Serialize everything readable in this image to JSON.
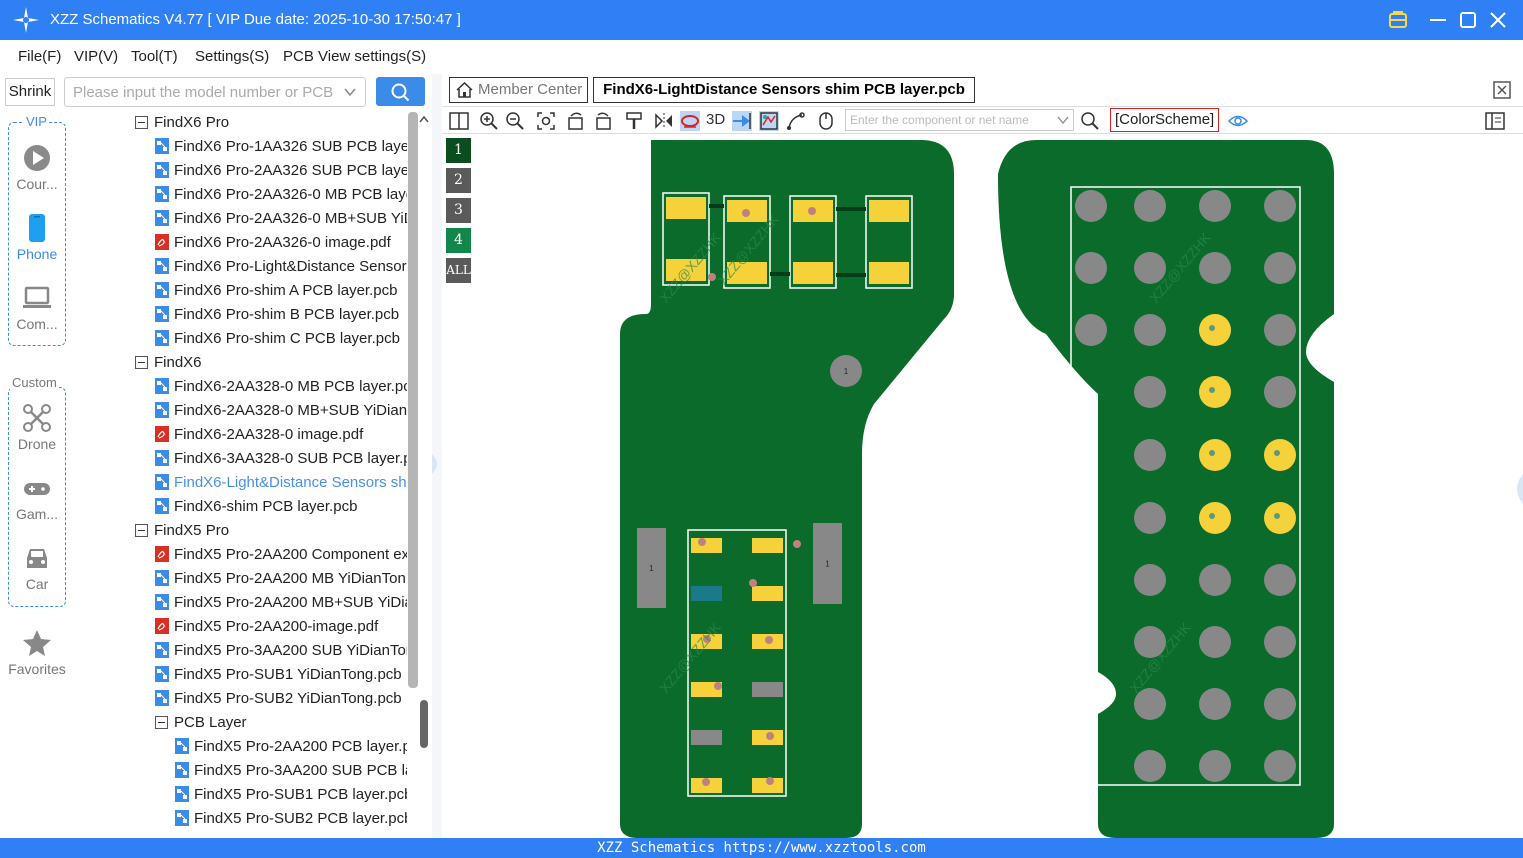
{
  "window": {
    "title": "XZZ Schematics V4.77 [ VIP Due date: 2025-10-30 17:50:47 ]"
  },
  "menu": [
    "File(F)",
    "VIP(V)",
    "Tool(T)",
    "Settings(S)",
    "PCB View settings(S)"
  ],
  "search": {
    "shrink_label": "Shrink",
    "placeholder": "Please input the model number or PCB"
  },
  "nav": {
    "vip_title": "VIP",
    "custom_title": "Custom",
    "items": [
      {
        "label": "Cour...",
        "icon": "play-icon"
      },
      {
        "label": "Phone",
        "icon": "phone-icon",
        "active": true
      },
      {
        "label": "Com...",
        "icon": "laptop-icon"
      },
      {
        "label": "Drone",
        "icon": "drone-icon"
      },
      {
        "label": "Gam...",
        "icon": "gamepad-icon"
      },
      {
        "label": "Car",
        "icon": "car-icon"
      },
      {
        "label": "Favorites",
        "icon": "star-icon"
      }
    ]
  },
  "tree": [
    {
      "label": "FindX6 Pro",
      "type": "folder",
      "level": 0
    },
    {
      "label": "FindX6 Pro-1AA326 SUB PCB layer.",
      "type": "pcb",
      "level": 1
    },
    {
      "label": "FindX6 Pro-2AA326 SUB PCB layer.",
      "type": "pcb",
      "level": 1
    },
    {
      "label": "FindX6 Pro-2AA326-0 MB PCB laye",
      "type": "pcb",
      "level": 1
    },
    {
      "label": "FindX6 Pro-2AA326-0 MB+SUB YiD",
      "type": "pcb",
      "level": 1
    },
    {
      "label": "FindX6 Pro-2AA326-0 image.pdf",
      "type": "pdf",
      "level": 1
    },
    {
      "label": "FindX6 Pro-Light&Distance Sensor",
      "type": "pcb",
      "level": 1
    },
    {
      "label": "FindX6 Pro-shim A PCB layer.pcb",
      "type": "pcb",
      "level": 1
    },
    {
      "label": "FindX6 Pro-shim B PCB layer.pcb",
      "type": "pcb",
      "level": 1
    },
    {
      "label": "FindX6 Pro-shim C PCB layer.pcb",
      "type": "pcb",
      "level": 1
    },
    {
      "label": "FindX6",
      "type": "folder",
      "level": 0
    },
    {
      "label": "FindX6-2AA328-0 MB PCB layer.pc",
      "type": "pcb",
      "level": 1
    },
    {
      "label": "FindX6-2AA328-0 MB+SUB YiDian",
      "type": "pcb",
      "level": 1
    },
    {
      "label": "FindX6-2AA328-0 image.pdf",
      "type": "pdf",
      "level": 1
    },
    {
      "label": "FindX6-3AA328-0 SUB PCB layer.pc",
      "type": "pcb",
      "level": 1
    },
    {
      "label": "FindX6-Light&Distance Sensors sh",
      "type": "pcb",
      "level": 1,
      "active": true
    },
    {
      "label": "FindX6-shim PCB layer.pcb",
      "type": "pcb",
      "level": 1
    },
    {
      "label": "FindX5 Pro",
      "type": "folder",
      "level": 0
    },
    {
      "label": "FindX5 Pro-2AA200 Component ex",
      "type": "pdf",
      "level": 1
    },
    {
      "label": "FindX5 Pro-2AA200 MB YiDianTon",
      "type": "pcb",
      "level": 1
    },
    {
      "label": "FindX5 Pro-2AA200 MB+SUB YiDia",
      "type": "pcb",
      "level": 1
    },
    {
      "label": "FindX5 Pro-2AA200-image.pdf",
      "type": "pdf",
      "level": 1
    },
    {
      "label": "FindX5 Pro-3AA200 SUB YiDianTor",
      "type": "pcb",
      "level": 1
    },
    {
      "label": "FindX5 Pro-SUB1 YiDianTong.pcb",
      "type": "pcb",
      "level": 1
    },
    {
      "label": "FindX5 Pro-SUB2 YiDianTong.pcb",
      "type": "pcb",
      "level": 1
    },
    {
      "label": "PCB Layer",
      "type": "folder",
      "level": 1
    },
    {
      "label": "FindX5 Pro-2AA200 PCB layer.p",
      "type": "pcb",
      "level": 2
    },
    {
      "label": "FindX5 Pro-3AA200 SUB PCB la",
      "type": "pcb",
      "level": 2
    },
    {
      "label": "FindX5 Pro-SUB1 PCB layer.pcb",
      "type": "pcb",
      "level": 2
    },
    {
      "label": "FindX5 Pro-SUB2 PCB layer.pcb",
      "type": "pcb",
      "level": 2
    }
  ],
  "tabs": {
    "member_center": "Member Center",
    "active_file": "FindX6-LightDistance Sensors shim PCB layer.pcb"
  },
  "toolbar": {
    "label_3d": "3D",
    "component_placeholder": "Enter the component or net name",
    "color_scheme": "[ColorScheme]"
  },
  "layers": [
    "1",
    "2",
    "3",
    "4",
    "ALL"
  ],
  "pcb": {
    "board_color": "#0a6b2a",
    "pad_color": "#f5d23a",
    "grey_pad_color": "#888888",
    "outline_color": "#ffffff",
    "component_label": "1",
    "watermark": "XZZ@XZZHK"
  },
  "status": {
    "text": "XZZ Schematics https://www.xzztools.com"
  },
  "colors": {
    "accent": "#2f7ff5",
    "active_tree": "#4a90e2",
    "pdf_red": "#d93025"
  }
}
